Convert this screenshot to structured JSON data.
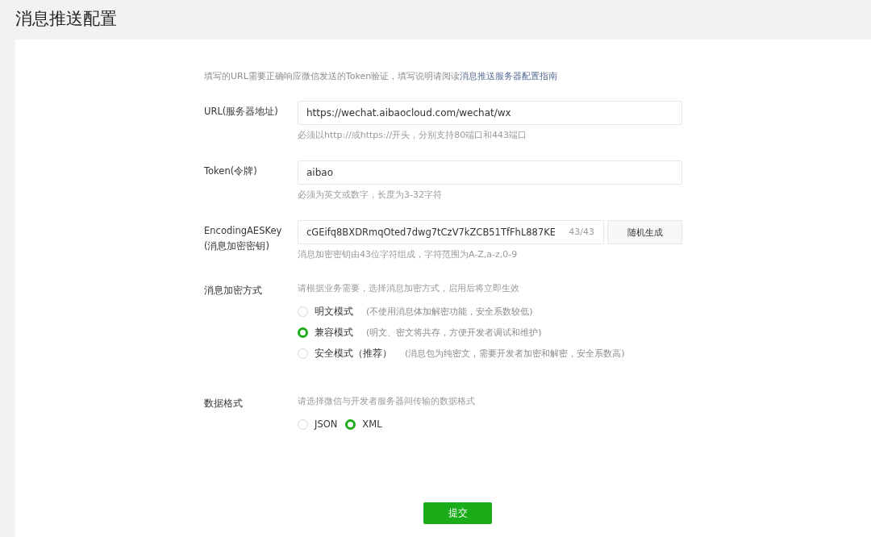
{
  "title": "消息推送配置",
  "intro": {
    "text": "填写的URL需要正确响应微信发送的Token验证，填写说明请阅读",
    "link": "消息推送服务器配置指南"
  },
  "fields": [
    {
      "label": "URL(服务器地址)",
      "value": "https://wechat.aibaocloud.com/wechat/wx",
      "hint": "必须以http://或https://开头，分别支持80端口和443端口"
    },
    {
      "label": "Token(令牌)",
      "value": "aibao",
      "hint": "必须为英文或数字，长度为3-32字符"
    },
    {
      "label": "EncodingAESKey",
      "sublabel": "(消息加密密钥)",
      "value": "cGEifq8BXDRmqOted7dwg7tCzV7kZCB51TfFhL887KE",
      "counter": "43/43",
      "button": "随机生成",
      "hint": "消息加密密钥由43位字符组成，字符范围为A-Z,a-z,0-9"
    }
  ],
  "encryption": {
    "label": "消息加密方式",
    "hint": "请根据业务需要，选择消息加密方式，启用后将立即生效",
    "options": [
      {
        "label": "明文模式",
        "note": "(不使用消息体加解密功能，安全系数较低)",
        "selected": false
      },
      {
        "label": "兼容模式",
        "note": "(明文、密文将共存，方便开发者调试和维护)",
        "selected": true
      },
      {
        "label": "安全模式（推荐）",
        "note": "(消息包为纯密文，需要开发者加密和解密，安全系数高)",
        "selected": false
      }
    ]
  },
  "format": {
    "label": "数据格式",
    "hint": "请选择微信与开发者服务器间传输的数据格式",
    "options": [
      {
        "label": "JSON",
        "selected": false
      },
      {
        "label": "XML",
        "selected": true
      }
    ]
  },
  "submit": "提交"
}
